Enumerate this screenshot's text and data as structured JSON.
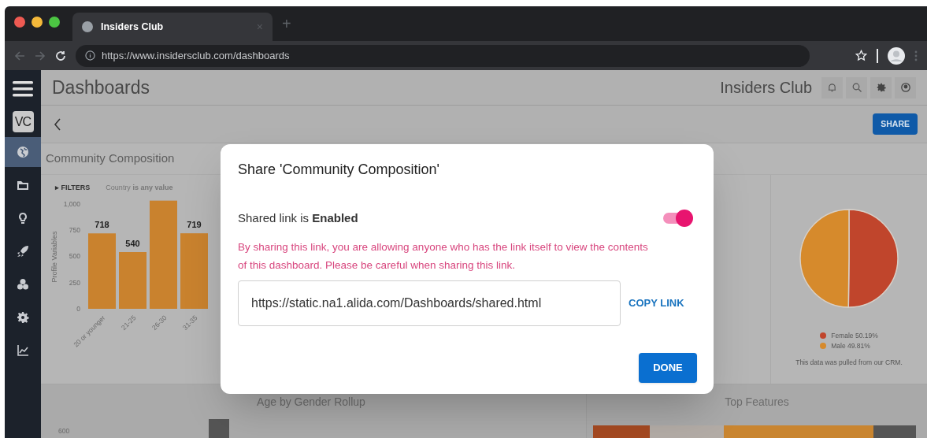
{
  "browser": {
    "tab": {
      "title": "Insiders Club",
      "close": "×"
    },
    "new_tab": "+",
    "url": "https://www.insidersclub.com/dashboards"
  },
  "sidebar": {
    "logo": "VC",
    "items": [
      {
        "kind": "globe",
        "selected": true
      },
      {
        "kind": "folder",
        "selected": false
      },
      {
        "kind": "bulb",
        "selected": false
      },
      {
        "kind": "rocket",
        "selected": false
      },
      {
        "kind": "cubes",
        "selected": false
      },
      {
        "kind": "gear",
        "selected": false
      },
      {
        "kind": "chart",
        "selected": false
      }
    ]
  },
  "header": {
    "title": "Dashboards",
    "brand": "Insiders Club"
  },
  "toolbar": {
    "share_button": "SHARE"
  },
  "community_card": {
    "title": "Community Composition",
    "filters": {
      "marker": "▸",
      "toggle": "FILTERS",
      "condition": "Country **is any value**"
    },
    "chart_data": {
      "type": "bar",
      "ylabel": "Profile Variables",
      "categories": [
        "20 or younger",
        "21-25",
        "26-30",
        "31-35"
      ],
      "series": [
        {
          "color": "#c9822e",
          "values": [
            718,
            540,
            1030,
            719
          ]
        }
      ],
      "ylim": [
        0,
        1050
      ],
      "yticks": [
        0,
        250,
        500,
        750,
        {
          "value": 1000,
          "label": "1,000"
        }
      ],
      "value_labels": [
        "718",
        "540",
        null,
        "719"
      ]
    }
  },
  "gender_panel": {
    "chart_data": {
      "type": "pie",
      "values": [
        50.19,
        49.81
      ]
    },
    "legend": [
      {
        "label": "Female 50.19%",
        "color": "#c0452c"
      },
      {
        "label": "Male 49.81%",
        "color": "#d68a2c"
      }
    ],
    "note": "This data was pulled from our CRM."
  },
  "age_gender_card": {
    "title": "Age by Gender Rollup",
    "axis_label": "600"
  },
  "top_features_card": {
    "title": "Top Features"
  },
  "dialog": {
    "title": "Share 'Community Composition'",
    "status": "Shared link is **Enabled**",
    "shared": {
      "on": true
    },
    "warning": "By sharing this link, you are allowing anyone who has the link itself to view the contents of this dashboard. Please be careful when sharing this link.",
    "link": "https://static.na1.alida.com/Dashboards/shared.html",
    "copy_button": "COPY LINK",
    "done_button": "DONE"
  }
}
